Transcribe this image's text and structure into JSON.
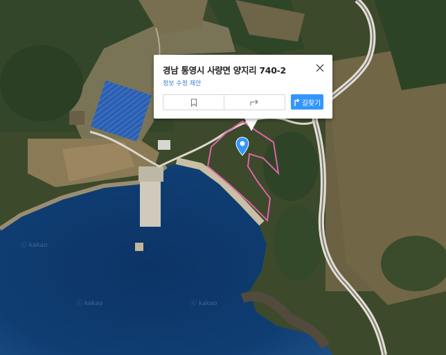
{
  "map": {
    "type": "satellite",
    "watermark": "ⓒ kakao",
    "marker": "location-pin-icon",
    "parcel_outline_color": "#e063a8"
  },
  "popup": {
    "address": "경남 통영시 사량면 양지리 740-2",
    "edit_link": "정보 수정 제안",
    "bookmark_icon": "bookmark-icon",
    "share_icon": "share-icon",
    "route_label": "길찾기",
    "route_icon": "route-icon",
    "close_icon": "close-icon",
    "accent_color": "#3396ff"
  }
}
